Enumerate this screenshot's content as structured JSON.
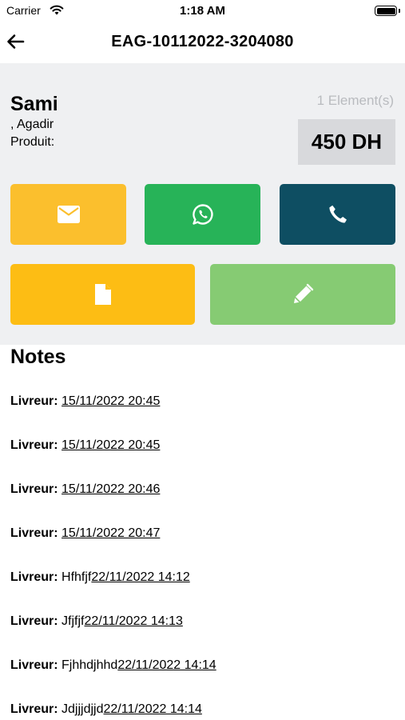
{
  "status_bar": {
    "carrier": "Carrier",
    "time": "1:18 AM"
  },
  "nav": {
    "title": "EAG-10112022-3204080"
  },
  "order": {
    "customer_name": "Sami",
    "city": ", Agadir",
    "product_label": "Produit:",
    "element_count": "1 Element(s)",
    "price": "450 DH"
  },
  "actions": {
    "email_icon": "envelope-icon",
    "whatsapp_icon": "whatsapp-icon",
    "call_icon": "phone-icon",
    "document_icon": "document-icon",
    "edit_icon": "pen-icon",
    "colors": {
      "email": "#fbbf2d",
      "whatsapp": "#27b358",
      "call": "#0e4e62",
      "document": "#fdbd14",
      "edit": "#86cb73"
    }
  },
  "notes": {
    "title": "Notes",
    "items": [
      {
        "label": "Livreur:",
        "text": "",
        "date": "15/11/2022 20:45"
      },
      {
        "label": "Livreur:",
        "text": "",
        "date": "15/11/2022 20:45"
      },
      {
        "label": "Livreur:",
        "text": "",
        "date": "15/11/2022 20:46"
      },
      {
        "label": "Livreur:",
        "text": "",
        "date": "15/11/2022 20:47"
      },
      {
        "label": "Livreur:",
        "text": "Hfhfjf",
        "date": "22/11/2022 14:12"
      },
      {
        "label": "Livreur:",
        "text": "Jfjfjf",
        "date": "22/11/2022 14:13"
      },
      {
        "label": "Livreur:",
        "text": "Fjhhdjhhd",
        "date": "22/11/2022 14:14"
      },
      {
        "label": "Livreur:",
        "text": "Jdjjjdjjd",
        "date": "22/11/2022 14:14"
      }
    ]
  }
}
